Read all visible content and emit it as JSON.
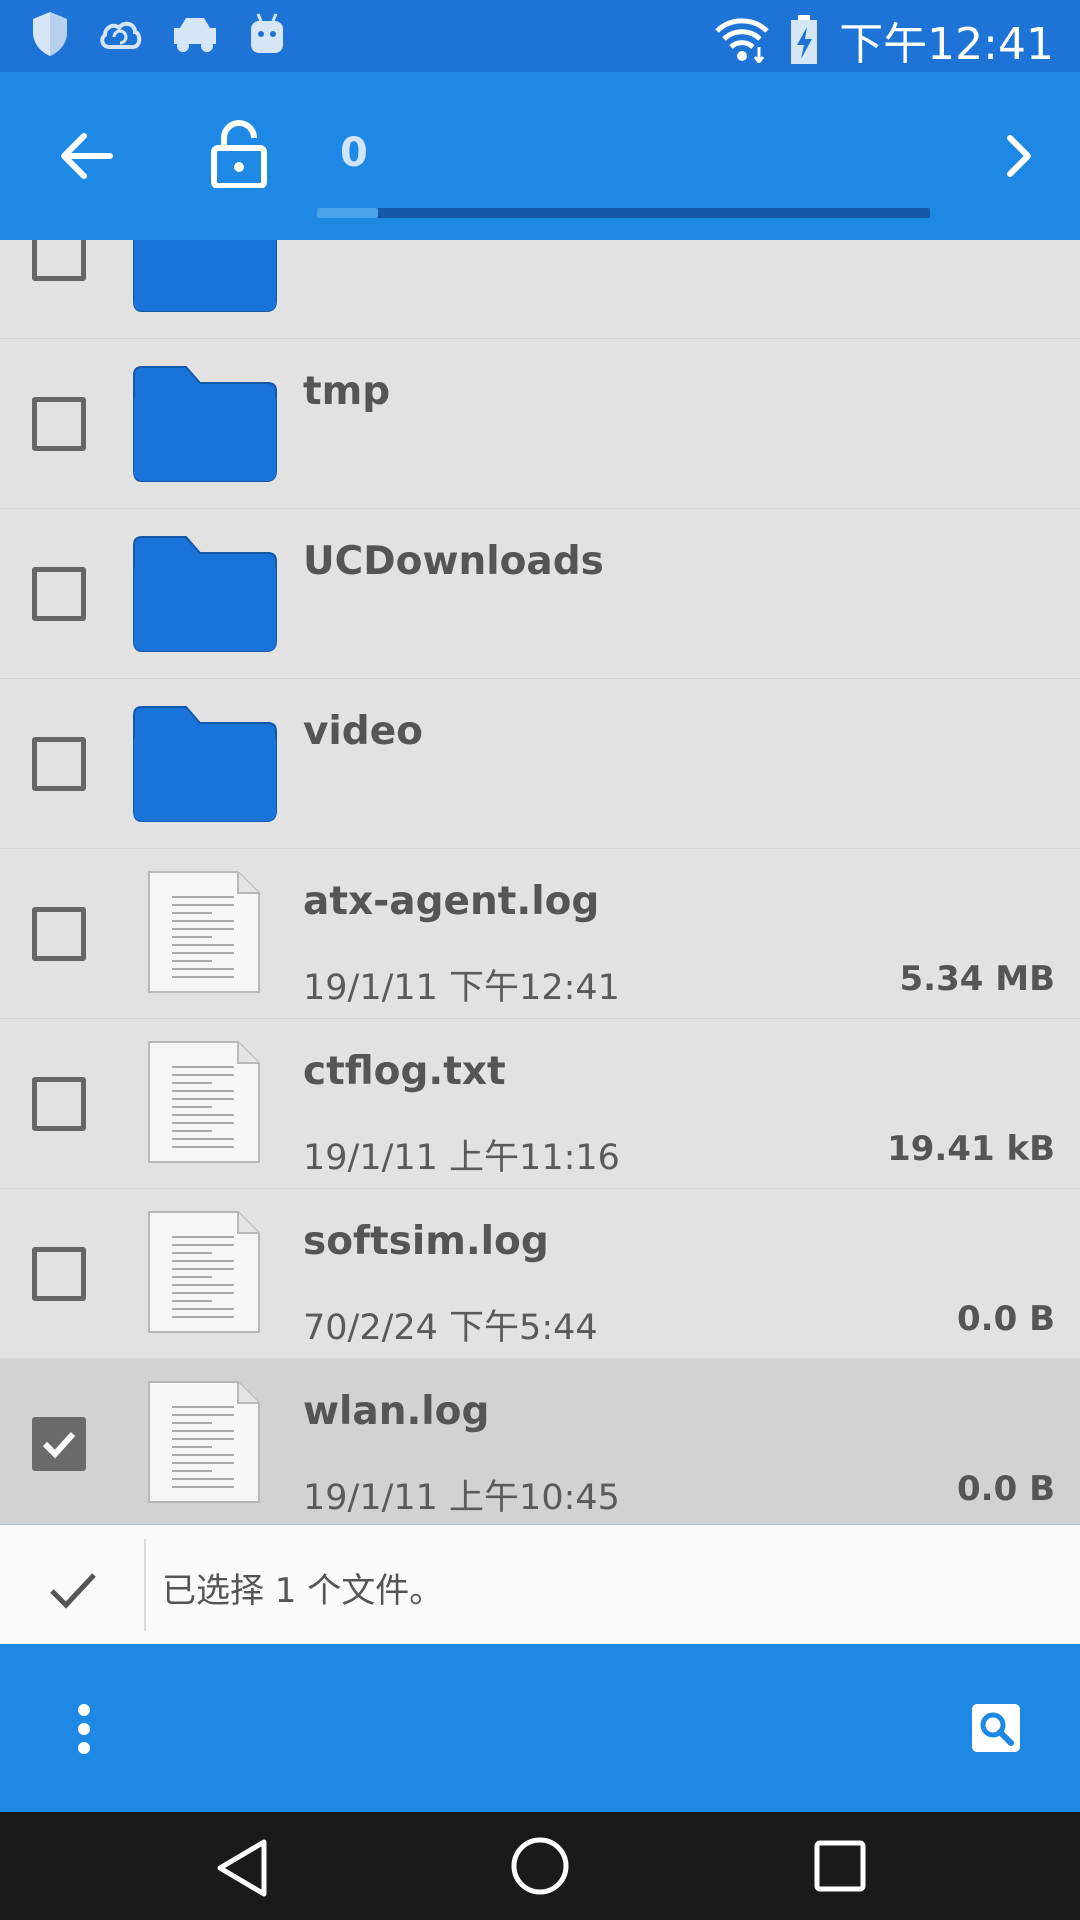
{
  "status_bar": {
    "time": "下午12:41",
    "left_icons": [
      "shield-icon",
      "cloud-sync-icon",
      "car-icon",
      "android-robot-icon"
    ],
    "right_icons": [
      "wifi-icon",
      "battery-charging-icon"
    ]
  },
  "toolbar": {
    "selected_count": "0",
    "progress_fraction": 0.1,
    "icons": [
      "back-arrow-icon",
      "unlock-icon",
      "chevron-right-icon"
    ]
  },
  "files": [
    {
      "name": "",
      "type": "folder",
      "date": "",
      "size": "",
      "checked": false
    },
    {
      "name": "tmp",
      "type": "folder",
      "date": "",
      "size": "",
      "checked": false
    },
    {
      "name": "UCDownloads",
      "type": "folder",
      "date": "",
      "size": "",
      "checked": false
    },
    {
      "name": "video",
      "type": "folder",
      "date": "",
      "size": "",
      "checked": false
    },
    {
      "name": "atx-agent.log",
      "type": "file",
      "date": "19/1/11 下午12:41",
      "size": "5.34 MB",
      "checked": false
    },
    {
      "name": "ctflog.txt",
      "type": "file",
      "date": "19/1/11 上午11:16",
      "size": "19.41 kB",
      "checked": false
    },
    {
      "name": "softsim.log",
      "type": "file",
      "date": "70/2/24 下午5:44",
      "size": "0.0 B",
      "checked": false
    },
    {
      "name": "wlan.log",
      "type": "file",
      "date": "19/1/11 上午10:45",
      "size": "0.0 B",
      "checked": true
    }
  ],
  "selection_bar": {
    "text": "已选择 1 个文件。"
  },
  "colors": {
    "status_bar": "#1d74d6",
    "toolbar": "#1e88e5",
    "list_bg": "#e2e2e2",
    "selected_row": "#d2d2d2",
    "folder": "#1a73d8",
    "nav_bar": "#1a1a1a"
  }
}
